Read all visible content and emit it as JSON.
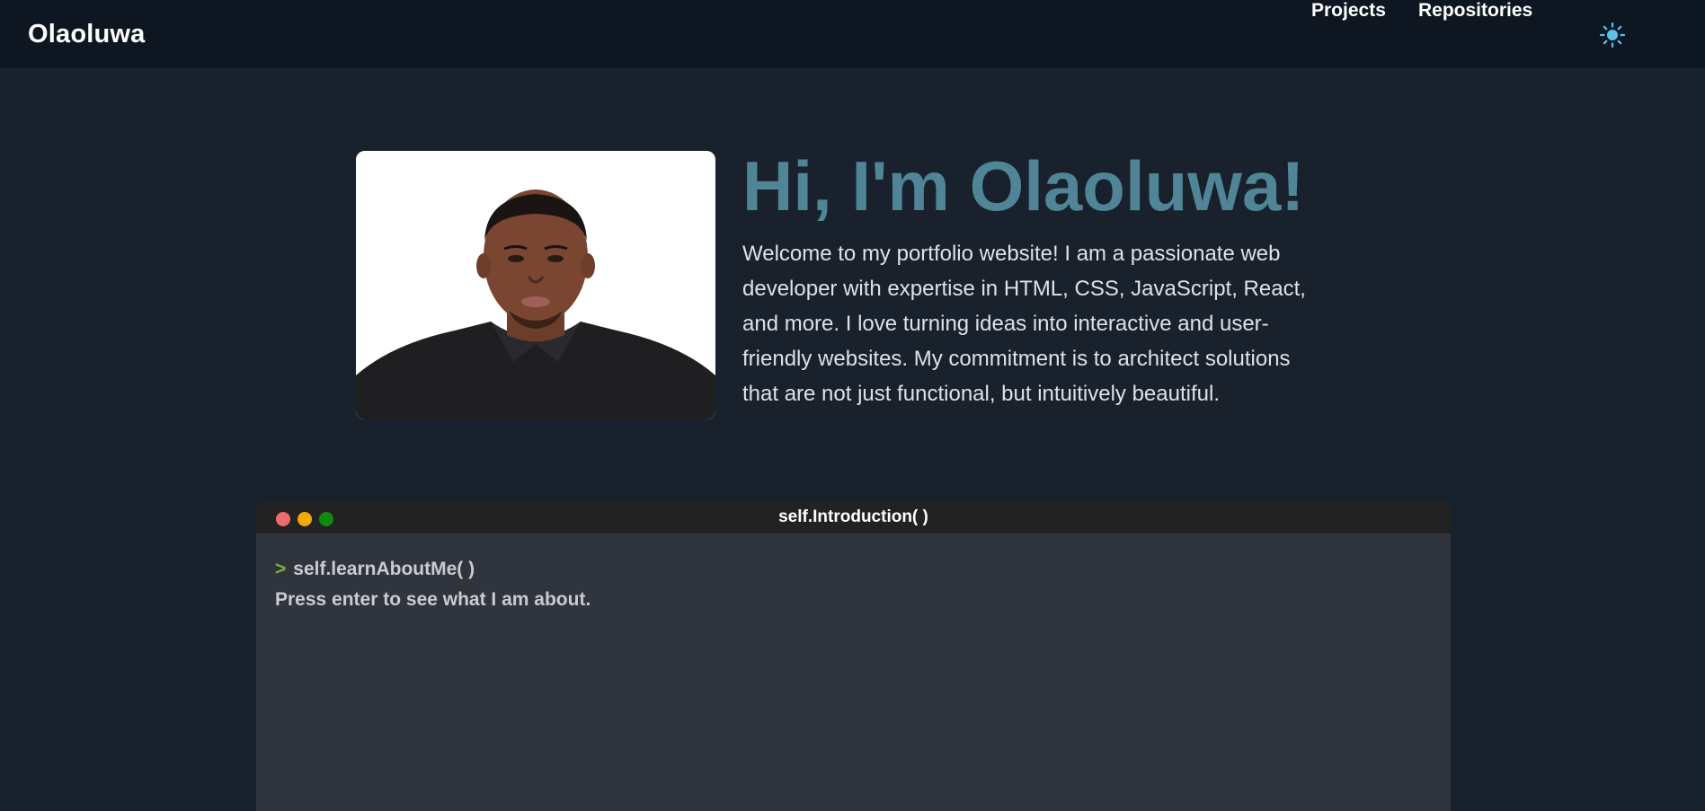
{
  "navbar": {
    "brand": "Olaoluwa",
    "links": [
      {
        "label": "Projects"
      },
      {
        "label": "Repositories"
      }
    ],
    "theme_toggle_icon": "sun-icon",
    "accent_color": "#5bc0eb"
  },
  "hero": {
    "photo_icon": "profile-photo",
    "title": "Hi, I'm Olaoluwa!",
    "title_color": "#4f8596",
    "description": "Welcome to my portfolio website! I am a passionate web developer with expertise in HTML, CSS, JavaScript, React, and more. I love turning ideas into interactive and user-friendly websites. My commitment is to architect solutions that are not just functional, but intuitively beautiful."
  },
  "terminal": {
    "title": "self.Introduction( )",
    "prompt_symbol": ">",
    "command": "self.learnAboutMe( )",
    "output": "Press enter to see what I am about.",
    "window_dots": [
      "#ee6b6e",
      "#f2a900",
      "#0f8a0f"
    ],
    "prompt_color": "#7db33c"
  }
}
